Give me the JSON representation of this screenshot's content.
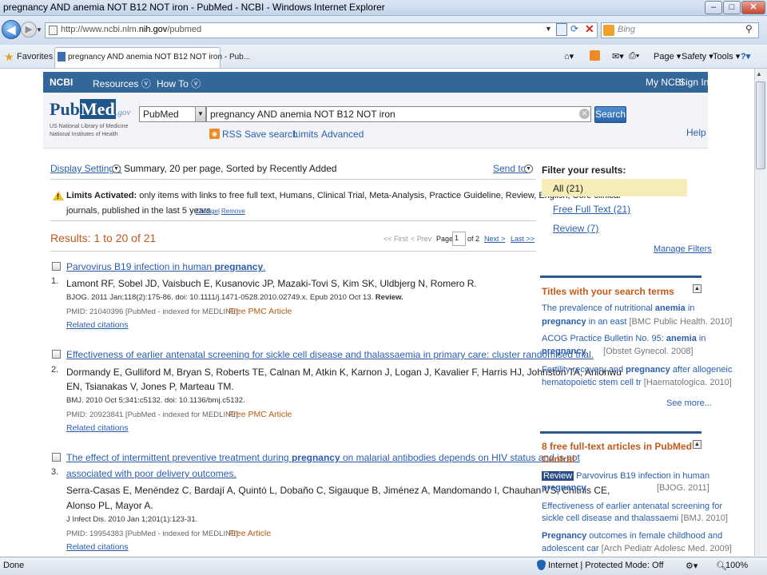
{
  "window": {
    "title": "pregnancy AND anemia NOT B12 NOT iron - PubMed - NCBI - Windows Internet Explorer",
    "minimize": "–",
    "maximize": "□",
    "close": "✕"
  },
  "browser": {
    "url_prefix": "http://www.ncbi.nlm.",
    "url_domain": "nih.gov",
    "url_suffix": "/pubmed",
    "search_engine": "Bing",
    "favorites_label": "Favorites",
    "tab_title": "pregnancy AND anemia NOT B12 NOT iron - Pub...",
    "cmd_page": "Page ▾",
    "cmd_safety": "Safety ▾",
    "cmd_tools": "Tools ▾",
    "cmd_help": "?▾"
  },
  "ncbi_bar": {
    "logo": "NCBI",
    "resources": "Resources",
    "howto": "How To",
    "myncbi": "My NCBI",
    "signin": "Sign In"
  },
  "header": {
    "logo_pub": "Pub",
    "logo_med": "Med",
    "logo_gov": ".gov",
    "subtitle1": "US National Library of Medicine",
    "subtitle2": "National Institutes of Health",
    "database": "PubMed",
    "query": "pregnancy AND anemia NOT B12 NOT iron",
    "search_btn": "Search",
    "rss": "RSS",
    "save_search": "Save search",
    "limits": "Limits",
    "advanced": "Advanced",
    "help": "Help"
  },
  "display": {
    "label": "Display Settings:",
    "value": "Summary, 20 per page, Sorted by Recently Added",
    "send_to": "Send to:"
  },
  "limits": {
    "label": "Limits Activated:",
    "text1": "only items with links to free full text, Humans, Clinical Trial, Meta-Analysis, Practice Guideline, Review, English, Core clinical",
    "text2": "journals, published in the last 5 years",
    "change": "Change",
    "sep": "|",
    "remove": "Remove"
  },
  "results": {
    "title": "Results: 1 to 20 of 21",
    "first": "<< First",
    "prev": "< Prev",
    "page_label": "Page",
    "page_value": "1",
    "of": "of 2",
    "next": "Next >",
    "last": "Last >>",
    "items": [
      {
        "num": "1.",
        "title_pre": "Parvovirus B19 infection in human ",
        "title_bold": "pregnancy",
        "title_post": ".",
        "title2": "",
        "authors1": "Lamont RF, Sobel JD, Vaisbuch E, Kusanovic JP, Mazaki-Tovi S, Kim SK, Uldbjerg N, Romero R.",
        "authors2": "",
        "cite": "BJOG. 2011 Jan;118(2):175-86. doi: 10.1111/j.1471-0528.2010.02749.x. Epub 2010 Oct 13. ",
        "cite_bold": "Review.",
        "pmid": "PMID: 21040396 [PubMed - indexed for MEDLINE]",
        "free": "Free PMC Article",
        "related": "Related citations"
      },
      {
        "num": "2.",
        "title_pre": "Effectiveness of earlier antenatal screening for sickle cell disease and thalassaemia in primary care: cluster randomised trial.",
        "title_bold": "",
        "title_post": "",
        "title2": "",
        "authors1": "Dormandy E, Gulliford M, Bryan S, Roberts TE, Calnan M, Atkin K, Karnon J, Logan J, Kavalier F, Harris HJ, Johnston TA, Anionwu",
        "authors2": "EN, Tsianakas V, Jones P, Marteau TM.",
        "cite": "BMJ. 2010 Oct 5;341:c5132. doi: 10.1136/bmj.c5132.",
        "cite_bold": "",
        "pmid": "PMID: 20923841 [PubMed - indexed for MEDLINE]",
        "free": "Free PMC Article",
        "related": "Related citations"
      },
      {
        "num": "3.",
        "title_pre": "The effect of intermittent preventive treatment during ",
        "title_bold": "pregnancy",
        "title_post": " on malarial antibodies depends on HIV status and is not",
        "title2": "associated with poor delivery outcomes.",
        "authors1": "Serra-Casas E, Menéndez C, Bardají A, Quintó L, Dobaño C, Sigauque B, Jiménez A, Mandomando I, Chauhan VS, Chitnis CE,",
        "authors2": "Alonso PL, Mayor A.",
        "cite": "J Infect Dis. 2010 Jan 1;201(1):123-31.",
        "cite_bold": "",
        "pmid": "PMID: 19954383 [PubMed - indexed for MEDLINE]",
        "free": "Free Article",
        "related": "Related citations"
      }
    ]
  },
  "sidebar": {
    "filter_title": "Filter your results:",
    "filters": [
      "All (21)",
      "Free Full Text (21)",
      "Review (7)"
    ],
    "manage": "Manage Filters",
    "titles_head": "Titles with your search terms",
    "titles": [
      {
        "a": "The prevalence of nutritional ",
        "b": "anemia",
        "c": " in",
        "d": "pregnancy",
        "e": " in an east ",
        "src": "[BMC Public Health. 2010]"
      },
      {
        "a": "ACOG Practice Bulletin No. 95: ",
        "b": "anemia",
        "c": " in",
        "d": "pregnancy",
        "e": ".",
        "src": "[Obstet Gynecol. 2008]"
      },
      {
        "a": "Fertility recovery and ",
        "b": "pregnancy",
        "c": " after allogeneic",
        "d": "",
        "e": "hematopoietic stem cell tr ",
        "src": "[Haematologica. 2010]"
      }
    ],
    "see_more": "See more...",
    "free_head1": "8 free full-text articles in PubMed",
    "free_head2": "Central",
    "free_items": [
      {
        "badge": "Review",
        "a": " Parvovirus B19 infection in human",
        "b": "pregnancy",
        "c": ".",
        "src": "[BJOG. 2011]"
      },
      {
        "badge": "",
        "a": "Effectiveness of earlier antenatal screening for",
        "b": "",
        "c": "sickle cell disease and thalassaemi ",
        "src": "[BMJ. 2010]"
      },
      {
        "badge": "",
        "a": "",
        "b": "Pregnancy",
        "c": " outcomes in female childhood and",
        "d": "adolescent car ",
        "src": "[Arch Pediatr Adolesc Med. 2009]"
      }
    ]
  },
  "status": {
    "done": "Done",
    "zone": "Internet | Protected Mode: Off",
    "zoom": "100%"
  }
}
